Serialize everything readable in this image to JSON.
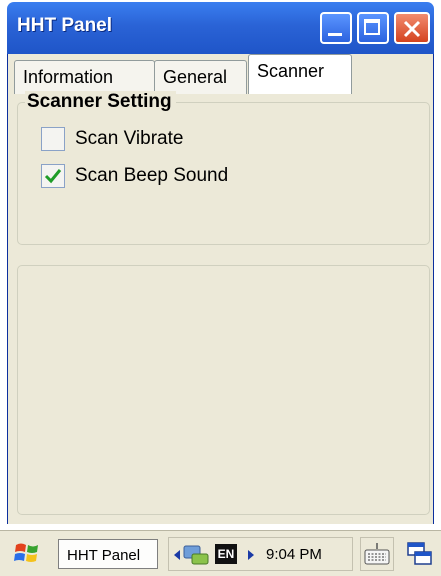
{
  "window": {
    "title": "HHT Panel",
    "title_color": "#2a63d6",
    "buttons": [
      "minimize-icon",
      "maximize-icon",
      "close-icon"
    ]
  },
  "tabs": [
    {
      "label": "Information",
      "selected": false
    },
    {
      "label": "General",
      "selected": false
    },
    {
      "label": "Scanner",
      "selected": true
    }
  ],
  "scanner_setting": {
    "group_label": "Scanner Setting",
    "options": [
      {
        "label": "Scan Vibrate",
        "checked": false
      },
      {
        "label": "Scan Beep Sound",
        "checked": true
      }
    ]
  },
  "taskbar": {
    "start_icon": "windows-flag-icon",
    "task_button": "HHT Panel",
    "tray": {
      "network_icon": "network-icon",
      "language": "EN",
      "time": "9:04 PM"
    },
    "keyboard_icon": "keyboard-icon",
    "desktop_icon": "show-desktop-icon"
  }
}
